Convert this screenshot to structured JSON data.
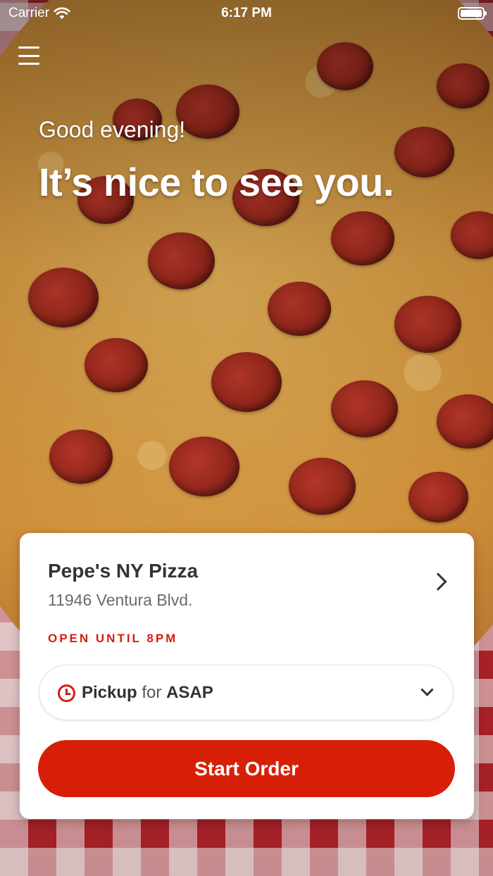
{
  "status_bar": {
    "carrier": "Carrier",
    "time": "6:17 PM",
    "icons": [
      "wifi-icon",
      "battery-icon"
    ]
  },
  "header": {
    "menu_icon": "hamburger-menu-icon",
    "greeting": "Good evening!",
    "headline": "It’s nice to see you."
  },
  "store": {
    "name": "Pepe's NY Pizza",
    "address": "11946 Ventura Blvd.",
    "hours_status": "OPEN UNTIL 8PM"
  },
  "order_mode": {
    "icon": "clock-icon",
    "mode": "Pickup",
    "connector": "for",
    "time": "ASAP"
  },
  "actions": {
    "start_order_label": "Start Order"
  },
  "colors": {
    "accent": "#d71f07",
    "text_dark": "#333333",
    "text_muted": "#6b6b6b",
    "card_bg": "#ffffff"
  }
}
